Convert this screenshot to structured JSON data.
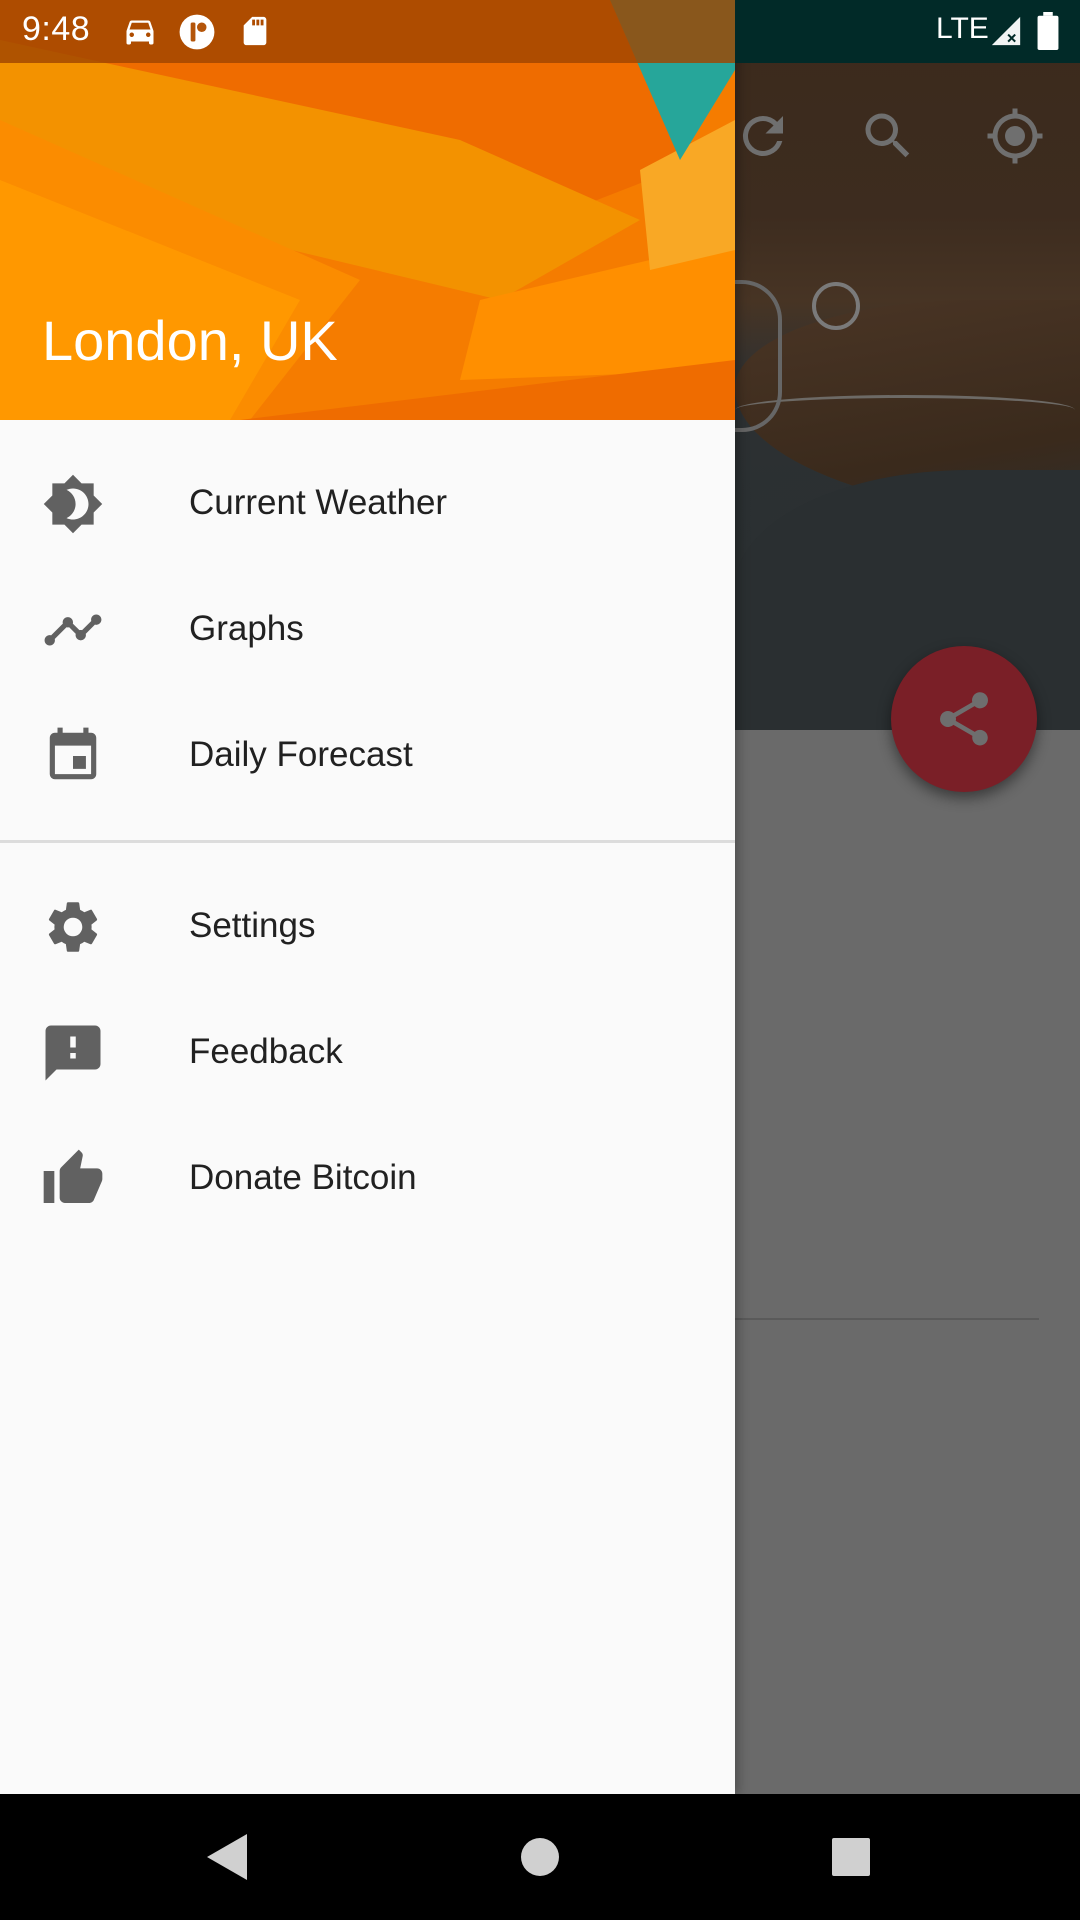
{
  "status_bar": {
    "time": "9:48",
    "network": "LTE",
    "icons": [
      "car-icon",
      "app-notification-icon",
      "sd-card-icon",
      "signal-icon",
      "battery-icon"
    ]
  },
  "drawer": {
    "header_title": "London, UK",
    "primary_items": [
      {
        "label": "Current Weather",
        "icon": "weather-icon"
      },
      {
        "label": "Graphs",
        "icon": "graph-icon"
      },
      {
        "label": "Daily Forecast",
        "icon": "calendar-icon"
      }
    ],
    "secondary_items": [
      {
        "label": "Settings",
        "icon": "gear-icon"
      },
      {
        "label": "Feedback",
        "icon": "feedback-icon"
      },
      {
        "label": "Donate Bitcoin",
        "icon": "thumbs-up-icon"
      }
    ]
  },
  "background_app": {
    "toolbar_icons": [
      "refresh-icon",
      "search-icon",
      "gps-icon"
    ],
    "fab_icon": "share-icon"
  },
  "colors": {
    "accent": "#f57c00",
    "fab": "#b0303a",
    "icon_gray": "#616161"
  }
}
